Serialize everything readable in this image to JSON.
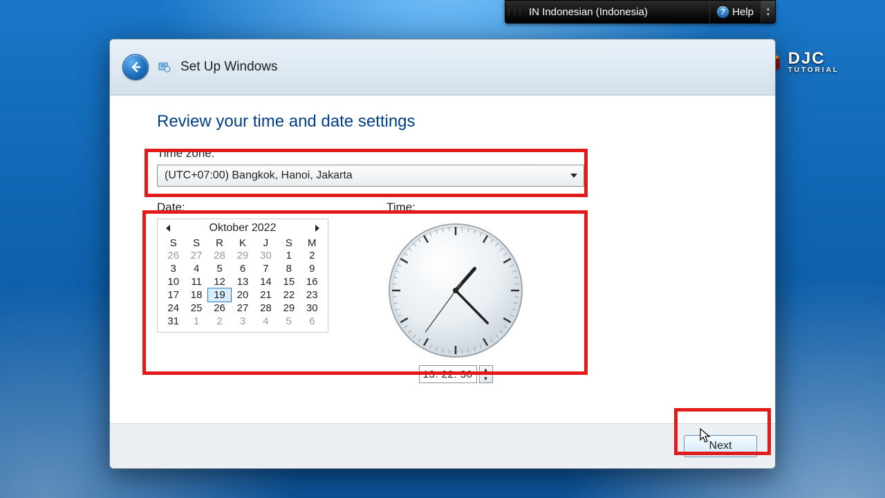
{
  "topbar": {
    "lang": "IN  Indonesian (Indonesia)",
    "help": "Help"
  },
  "logo": {
    "line1": "DJC",
    "line2": "TUTORIAL"
  },
  "window": {
    "title": "Set Up Windows",
    "heading": "Review your time and date settings",
    "tz_label": "Time zone:",
    "tz_value": "(UTC+07:00) Bangkok, Hanoi, Jakarta",
    "date_label": "Date:",
    "time_label": "Time:",
    "next": "Next"
  },
  "calendar": {
    "month": "Oktober 2022",
    "dow": [
      "S",
      "S",
      "R",
      "K",
      "J",
      "S",
      "M"
    ],
    "leading": [
      "26",
      "27",
      "28",
      "29",
      "30"
    ],
    "days": [
      "1",
      "2",
      "3",
      "4",
      "5",
      "6",
      "7",
      "8",
      "9",
      "10",
      "11",
      "12",
      "13",
      "14",
      "15",
      "16",
      "17",
      "18",
      "19",
      "20",
      "21",
      "22",
      "23",
      "24",
      "25",
      "26",
      "27",
      "28",
      "29",
      "30",
      "31"
    ],
    "trailing": [
      "1",
      "2",
      "3",
      "4",
      "5",
      "6"
    ],
    "selected": "19"
  },
  "time": {
    "display": "13: 22: 36",
    "h": 13,
    "m": 22,
    "s": 36
  }
}
